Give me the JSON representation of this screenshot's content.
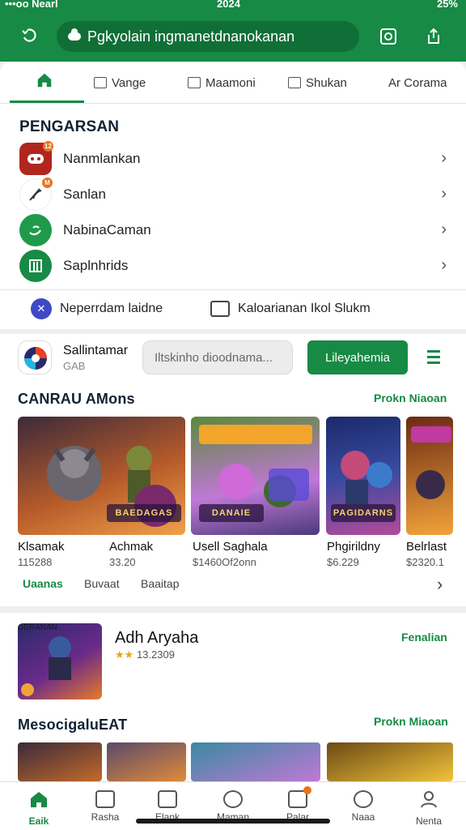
{
  "status": {
    "carrier": "•••oo Nearl",
    "time": "2024",
    "battery": "25%"
  },
  "header": {
    "url": "Pgkyolain ingmanetdnanokanan"
  },
  "tabs": [
    {
      "label": ""
    },
    {
      "label": "Vange"
    },
    {
      "label": "Maamoni"
    },
    {
      "label": "Shukan"
    },
    {
      "label": "Ar Corama"
    }
  ],
  "section1": {
    "title": "PENGARSAN",
    "rows": [
      {
        "label": "Nanmlankan",
        "icon": "game-controller-icon",
        "badge": "12",
        "color": "#b0261f"
      },
      {
        "label": "Sanlan",
        "icon": "feather-pen-icon",
        "badge": "M",
        "color": "#ffffff"
      },
      {
        "label": "NabinaCaman",
        "icon": "leaf-icon",
        "badge": "",
        "color": "#1f9a4b"
      },
      {
        "label": "Saplnhrids",
        "icon": "book-icon",
        "badge": "",
        "color": "#178a45"
      }
    ]
  },
  "quick": {
    "left": "Neperrdam laidne",
    "right": "Kaloarianan Ikol Slukm"
  },
  "app": {
    "name": "Sallintamar",
    "sub": "GAB",
    "search_placeholder": "Iltskinho dioodnama...",
    "button": "Lileyahemia"
  },
  "section2": {
    "title": "CANRAU AMons",
    "more": "Prokn Niaoan",
    "cards": [
      {
        "title": "Klsamak",
        "price": "115288",
        "art": "BAEDAGAS",
        "c1": "#7a3a1e",
        "c2": "#e88a3a"
      },
      {
        "title": "Achmak",
        "price": "33.20",
        "art": "",
        "c1": "#7a3a1e",
        "c2": "#e88a3a"
      },
      {
        "title": "Usell Saghala",
        "price": "$1460Of2onn",
        "art": "DANAIE",
        "c1": "#3f8a34",
        "c2": "#b46ad8"
      },
      {
        "title": "Phgirildny",
        "price": "$6.229",
        "art": "PAGIDARNS",
        "c1": "#1b2a6b",
        "c2": "#b44b9a"
      },
      {
        "title": "Belrlast",
        "price": "$2320.1",
        "art": "",
        "c1": "#6b2b14",
        "c2": "#f2a23a"
      }
    ],
    "subtabs": [
      "Uaanas",
      "Buvaat",
      "Baaitap"
    ]
  },
  "featured": {
    "title": "Adh Aryaha",
    "rating": "13.2309",
    "action": "Fenalian",
    "art": "DERANAN"
  },
  "section3": {
    "title": "MesocigaluEAT",
    "more": "Prokn Miaoan"
  },
  "bottom_nav": [
    {
      "label": "Eaik",
      "icon": "home-icon"
    },
    {
      "label": "Rasha",
      "icon": "chart-icon"
    },
    {
      "label": "Elank",
      "icon": "square-icon"
    },
    {
      "label": "Maman",
      "icon": "compass-icon"
    },
    {
      "label": "Palar",
      "icon": "calendar-icon"
    },
    {
      "label": "Naaa",
      "icon": "clock-icon"
    },
    {
      "label": "Nenta",
      "icon": "person-icon"
    }
  ],
  "colors": {
    "brand": "#178a45",
    "accent": "#e8731f"
  }
}
